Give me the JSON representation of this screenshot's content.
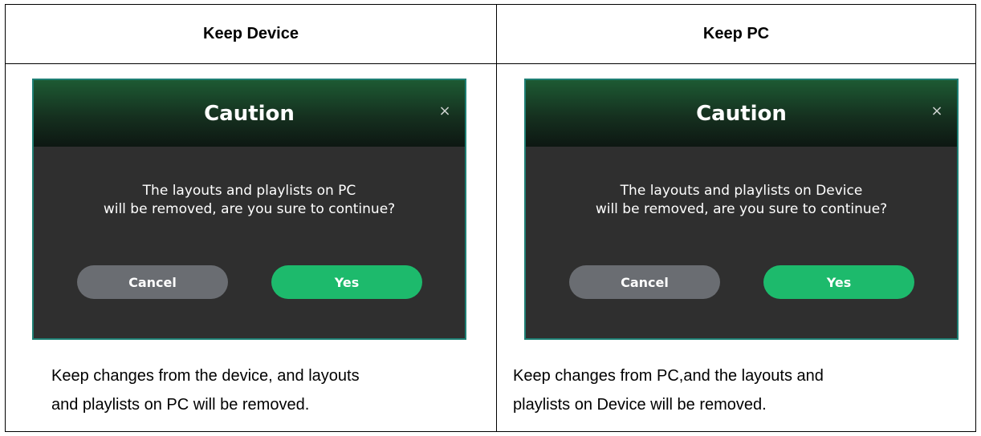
{
  "columns": [
    {
      "header": "Keep Device",
      "dialog": {
        "title": "Caution",
        "close_icon": "×",
        "message_line1": "The layouts and playlists on PC",
        "message_line2": "will be removed, are you sure to continue?",
        "cancel_label": "Cancel",
        "yes_label": "Yes"
      },
      "caption_line1": "Keep changes from the device, and layouts",
      "caption_line2": "and playlists on PC will be removed."
    },
    {
      "header": "Keep PC",
      "dialog": {
        "title": "Caution",
        "close_icon": "×",
        "message_line1": "The layouts and playlists on Device",
        "message_line2": "will be removed, are you sure to continue?",
        "cancel_label": "Cancel",
        "yes_label": "Yes"
      },
      "caption_line1": "Keep changes from PC,and the layouts and",
      "caption_line2": "playlists on Device will be removed."
    }
  ],
  "colors": {
    "dialog_border": "#1e7f74",
    "dialog_body": "#2f2f2f",
    "header_gradient_top": "#1d5a33",
    "header_gradient_bottom": "#0d1712",
    "cancel_button": "#6a6d72",
    "yes_button": "#1dba6c"
  },
  "icons": {
    "close": "close-icon"
  }
}
